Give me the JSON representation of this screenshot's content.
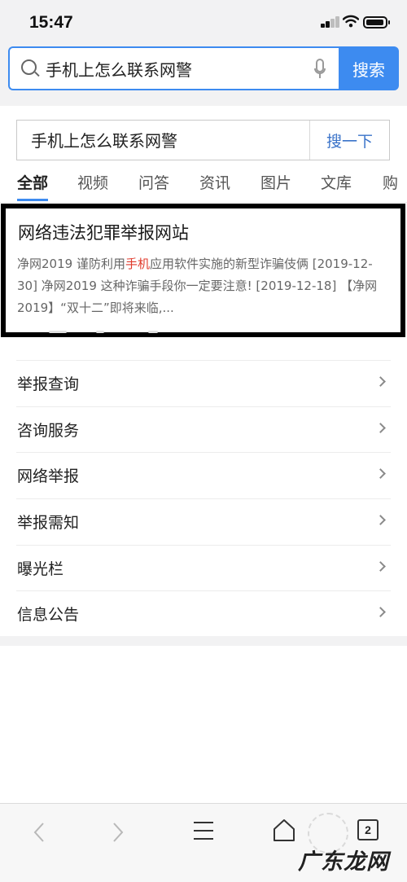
{
  "status": {
    "time": "15:47"
  },
  "browser": {
    "query": "手机上怎么联系网警",
    "search_button": "搜索",
    "icons": {
      "search": "magnifier-icon",
      "mic": "microphone-icon"
    }
  },
  "page_search": {
    "query": "手机上怎么联系网警",
    "button": "搜一下"
  },
  "tabs": [
    {
      "label": "全部",
      "active": true
    },
    {
      "label": "视频"
    },
    {
      "label": "问答"
    },
    {
      "label": "资讯"
    },
    {
      "label": "图片"
    },
    {
      "label": "文库"
    },
    {
      "label": "购"
    }
  ],
  "result": {
    "title": "网络违法犯罪举报网站",
    "desc_pre": "净网2019 谨防利用",
    "desc_highlight": "手机",
    "desc_post": "应用软件实施的新型诈骗伎俩 [2019-12-30] 净网2019 这种诈骗手段你一定要注意! [2019-12-18] 【净网2019】“双十二”即将来临,..."
  },
  "links": [
    {
      "label": "举报查询"
    },
    {
      "label": "咨询服务"
    },
    {
      "label": "网络举报"
    },
    {
      "label": "举报需知"
    },
    {
      "label": "曝光栏"
    },
    {
      "label": "信息公告"
    }
  ],
  "bottom_nav": {
    "tab_count": "2",
    "icons": [
      "back-arrow-icon",
      "forward-arrow-icon",
      "menu-icon",
      "home-icon",
      "tabs-icon"
    ]
  },
  "watermark": {
    "text": "广东龙网"
  },
  "colors": {
    "accent": "#3d8bf0",
    "link_blue": "#3a73c9",
    "highlight": "#e03a2c"
  }
}
